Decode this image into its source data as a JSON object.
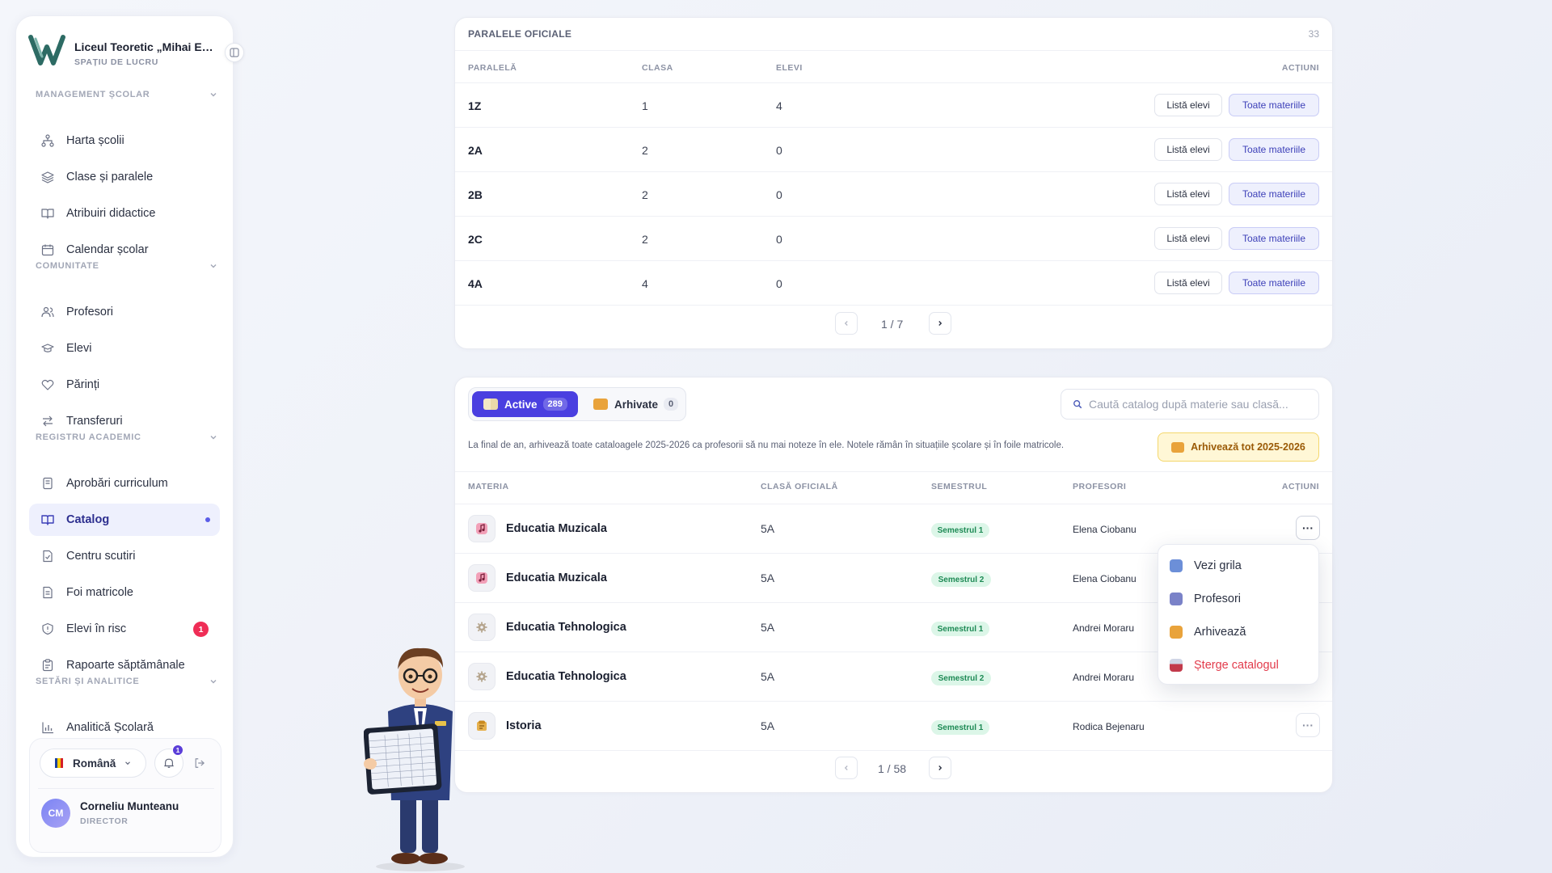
{
  "sidebar": {
    "school_name": "Liceul Teoretic „Mihai Eminescu”",
    "workspace_label": "SPAȚIU DE LUCRU",
    "sections": [
      {
        "title": "MANAGEMENT ȘCOLAR",
        "items": [
          {
            "label": "Harta școlii",
            "icon": "hierarchy-icon"
          },
          {
            "label": "Clase și paralele",
            "icon": "layers-icon"
          },
          {
            "label": "Atribuiri didactice",
            "icon": "book-open-icon"
          },
          {
            "label": "Calendar școlar",
            "icon": "calendar-icon"
          }
        ]
      },
      {
        "title": "COMUNITATE",
        "items": [
          {
            "label": "Profesori",
            "icon": "users-icon"
          },
          {
            "label": "Elevi",
            "icon": "graduation-cap-icon"
          },
          {
            "label": "Părinți",
            "icon": "heart-icon"
          },
          {
            "label": "Transferuri",
            "icon": "transfer-arrows-icon"
          }
        ]
      },
      {
        "title": "REGISTRU ACADEMIC",
        "items": [
          {
            "label": "Aprobări curriculum",
            "icon": "curriculum-icon"
          },
          {
            "label": "Catalog",
            "icon": "book-open-icon",
            "active": true
          },
          {
            "label": "Centru scutiri",
            "icon": "document-check-icon"
          },
          {
            "label": "Foi matricole",
            "icon": "document-icon"
          },
          {
            "label": "Elevi în risc",
            "icon": "shield-icon",
            "badge": "1"
          },
          {
            "label": "Rapoarte săptămânale",
            "icon": "clipboard-icon"
          }
        ]
      },
      {
        "title": "SETĂRI ȘI ANALITICE",
        "items": [
          {
            "label": "Analitică Școlară",
            "icon": "bar-chart-icon"
          }
        ]
      }
    ],
    "footer": {
      "language": "Română",
      "notifications_count": "1",
      "user_initials": "CM",
      "user_name": "Corneliu Munteanu",
      "user_role": "DIRECTOR"
    }
  },
  "paralele": {
    "title": "PARALELE OFICIALE",
    "count": "33",
    "headers": {
      "paralela": "PARALELĂ",
      "clasa": "CLASA",
      "elevi": "ELEVI",
      "actiuni": "ACȚIUNI"
    },
    "rows": [
      {
        "paralela": "1Z",
        "clasa": "1",
        "elevi": "4"
      },
      {
        "paralela": "2A",
        "clasa": "2",
        "elevi": "0"
      },
      {
        "paralela": "2B",
        "clasa": "2",
        "elevi": "0"
      },
      {
        "paralela": "2C",
        "clasa": "2",
        "elevi": "0"
      },
      {
        "paralela": "4A",
        "clasa": "4",
        "elevi": "0"
      }
    ],
    "btn_lista": "Listă elevi",
    "btn_materii": "Toate materiile",
    "pager": "1 / 7"
  },
  "catalog": {
    "tab_active": {
      "label": "Active",
      "count": "289"
    },
    "tab_archived": {
      "label": "Arhivate",
      "count": "0"
    },
    "search_placeholder": "Caută catalog după materie sau clasă...",
    "notice": "La final de an, arhivează toate cataloagele 2025-2026 ca profesorii să nu mai noteze în ele. Notele rămân în situațiile școlare și în foile matricole.",
    "archive_all": "Arhivează tot 2025-2026",
    "headers": {
      "materia": "MATERIA",
      "clasa": "CLASĂ OFICIALĂ",
      "semestrul": "SEMESTRUL",
      "profesori": "PROFESORI",
      "actiuni": "ACȚIUNI"
    },
    "rows": [
      {
        "materia": "Educatia Muzicala",
        "clasa": "5A",
        "semestrul": "Semestrul 1",
        "profesori": "Elena Ciobanu",
        "icon": "music-note-icon"
      },
      {
        "materia": "Educatia Muzicala",
        "clasa": "5A",
        "semestrul": "Semestrul 2",
        "profesori": "Elena Ciobanu",
        "icon": "music-note-icon"
      },
      {
        "materia": "Educatia Tehnologica",
        "clasa": "5A",
        "semestrul": "Semestrul 1",
        "profesori": "Andrei Moraru",
        "icon": "gear-icon"
      },
      {
        "materia": "Educatia Tehnologica",
        "clasa": "5A",
        "semestrul": "Semestrul 2",
        "profesori": "Andrei Moraru",
        "icon": "gear-icon"
      },
      {
        "materia": "Istoria",
        "clasa": "5A",
        "semestrul": "Semestrul 1",
        "profesori": "Rodica Bejenaru",
        "icon": "scroll-icon"
      }
    ],
    "menu": [
      "Vezi grila",
      "Profesori",
      "Arhivează",
      "Șterge catalogul"
    ],
    "pager": "1 / 58"
  },
  "colors": {
    "accent": "#4a3fe0",
    "danger": "#e23b4b",
    "success": "#1e8a55",
    "warning": "#9a5a06"
  }
}
